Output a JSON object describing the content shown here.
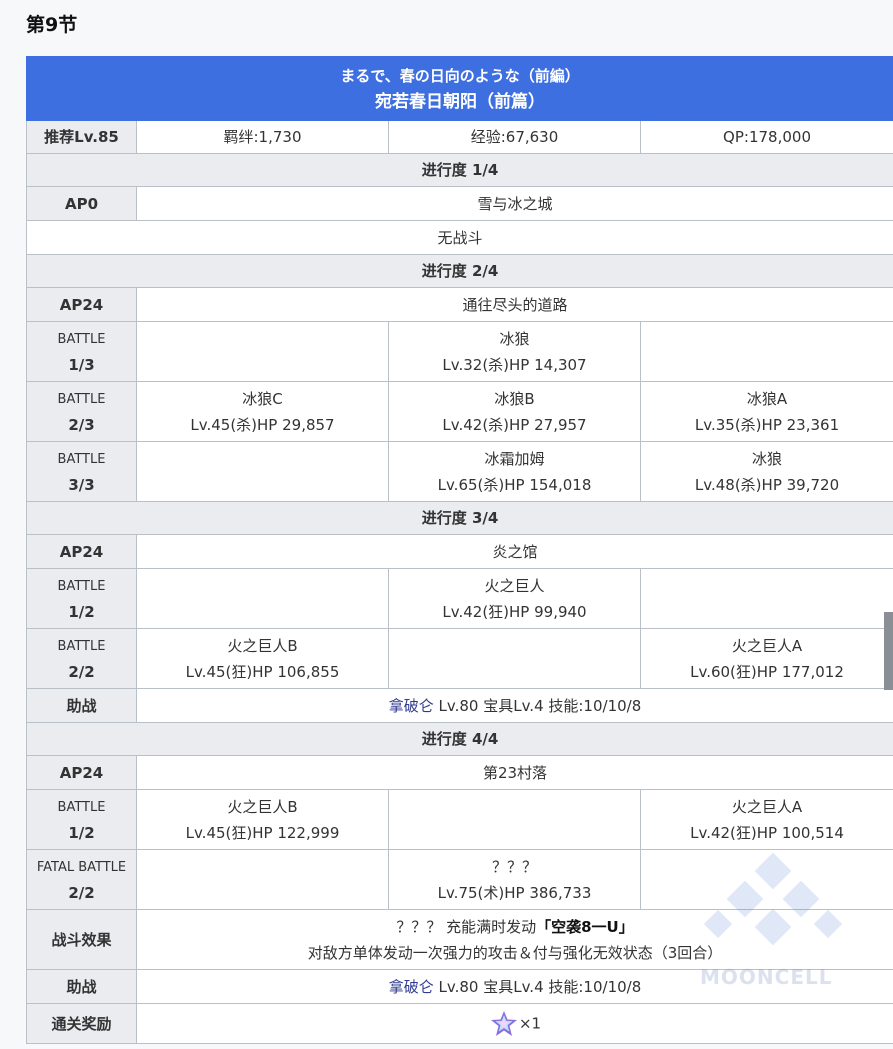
{
  "section_title": "第9节",
  "quest": {
    "name_jp": "まるで、春の日向のような（前編）",
    "name_cn": "宛若春日朝阳（前篇）",
    "rec_level": "推荐Lv.85",
    "bond": "羁绊:1,730",
    "exp": "经验:67,630",
    "qp": "QP:178,000"
  },
  "progress": [
    {
      "title": "进行度 1/4",
      "ap": "AP0",
      "location": "雪与冰之城",
      "note": "无战斗"
    },
    {
      "title": "进行度 2/4",
      "ap": "AP24",
      "location": "通往尽头的道路",
      "battles": [
        {
          "label_top": "BATTLE",
          "label_bottom": "1/3",
          "e1_name": "",
          "e1_stats": "",
          "e2_name": "冰狼",
          "e2_stats": "Lv.32(杀)HP 14,307",
          "e3_name": "",
          "e3_stats": ""
        },
        {
          "label_top": "BATTLE",
          "label_bottom": "2/3",
          "e1_name": "冰狼C",
          "e1_stats": "Lv.45(杀)HP 29,857",
          "e2_name": "冰狼B",
          "e2_stats": "Lv.42(杀)HP 27,957",
          "e3_name": "冰狼A",
          "e3_stats": "Lv.35(杀)HP 23,361"
        },
        {
          "label_top": "BATTLE",
          "label_bottom": "3/3",
          "e1_name": "",
          "e1_stats": "",
          "e2_name": "冰霜加姆",
          "e2_stats": "Lv.65(杀)HP 154,018",
          "e3_name": "冰狼",
          "e3_stats": "Lv.48(杀)HP 39,720"
        }
      ]
    },
    {
      "title": "进行度 3/4",
      "ap": "AP24",
      "location": "炎之馆",
      "battles": [
        {
          "label_top": "BATTLE",
          "label_bottom": "1/2",
          "e1_name": "",
          "e1_stats": "",
          "e2_name": "火之巨人",
          "e2_stats": "Lv.42(狂)HP 99,940",
          "e3_name": "",
          "e3_stats": ""
        },
        {
          "label_top": "BATTLE",
          "label_bottom": "2/2",
          "e1_name": "火之巨人B",
          "e1_stats": "Lv.45(狂)HP 106,855",
          "e2_name": "",
          "e2_stats": "",
          "e3_name": "火之巨人A",
          "e3_stats": "Lv.60(狂)HP 177,012"
        }
      ],
      "support_label": "助战",
      "support_name": "拿破仑",
      "support_info": " Lv.80 宝具Lv.4 技能:10/10/8"
    },
    {
      "title": "进行度 4/4",
      "ap": "AP24",
      "location": "第23村落",
      "battles": [
        {
          "label_top": "BATTLE",
          "label_bottom": "1/2",
          "e1_name": "火之巨人B",
          "e1_stats": "Lv.45(狂)HP 122,999",
          "e2_name": "",
          "e2_stats": "",
          "e3_name": "火之巨人A",
          "e3_stats": "Lv.42(狂)HP 100,514"
        },
        {
          "label_top": "FATAL BATTLE",
          "label_bottom": "2/2",
          "e1_name": "",
          "e1_stats": "",
          "e2_name": "？？？",
          "e2_stats": "Lv.75(术)HP 386,733",
          "e3_name": "",
          "e3_stats": ""
        }
      ],
      "effect_label": "战斗效果",
      "effect_line1_prefix": "？？？ 充能满时发动",
      "effect_line1_skill": "「空袭8一U」",
      "effect_line2": "对敌方单体发动一次强力的攻击＆付与强化无效状态（3回合）",
      "support_label": "助战",
      "support_name": "拿破仑",
      "support_info": " Lv.80 宝具Lv.4 技能:10/10/8",
      "reward_label": "通关奖励",
      "reward_icon": "saint-quartz-icon",
      "reward_count": "×1"
    }
  ],
  "watermark": "MOONCELL",
  "colors": {
    "header_bg": "#3e6fe0",
    "label_bg": "#eaecf0",
    "border": "#b9c0c8",
    "link": "#2f3a8f"
  }
}
